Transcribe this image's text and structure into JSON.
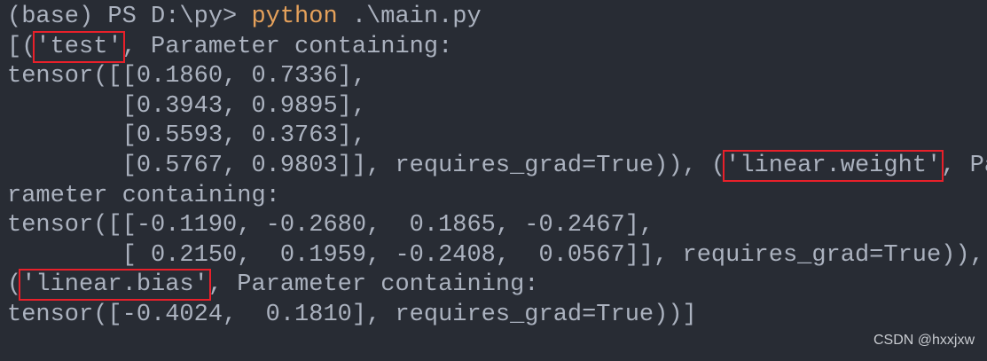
{
  "terminal": {
    "prompt": "(base) PS D:\\py> ",
    "command": "python",
    "args": " .\\main.py",
    "line2_pre": "[(",
    "line2_hl": "'test'",
    "line2_post": ", Parameter containing:",
    "line3": "tensor([[0.1860, 0.7336],",
    "line4": "        [0.3943, 0.9895],",
    "line5": "        [0.5593, 0.3763],",
    "line6_pre": "        [0.5767, 0.9803]], requires_grad=True)), (",
    "line6_hl": "'linear.weight'",
    "line6_post": ", Pa",
    "line7": "rameter containing:",
    "line8": "tensor([[-0.1190, -0.2680,  0.1865, -0.2467],",
    "line9": "        [ 0.2150,  0.1959, -0.2408,  0.0567]], requires_grad=True)),",
    "line10_pre": "(",
    "line10_hl": "'linear.bias'",
    "line10_post": ", Parameter containing:",
    "line11": "tensor([-0.4024,  0.1810], requires_grad=True))]"
  },
  "watermark": "CSDN @hxxjxw",
  "colors": {
    "background": "#282c34",
    "text": "#abb2bf",
    "command": "#e5a15b",
    "highlight_box": "#e8202a"
  }
}
